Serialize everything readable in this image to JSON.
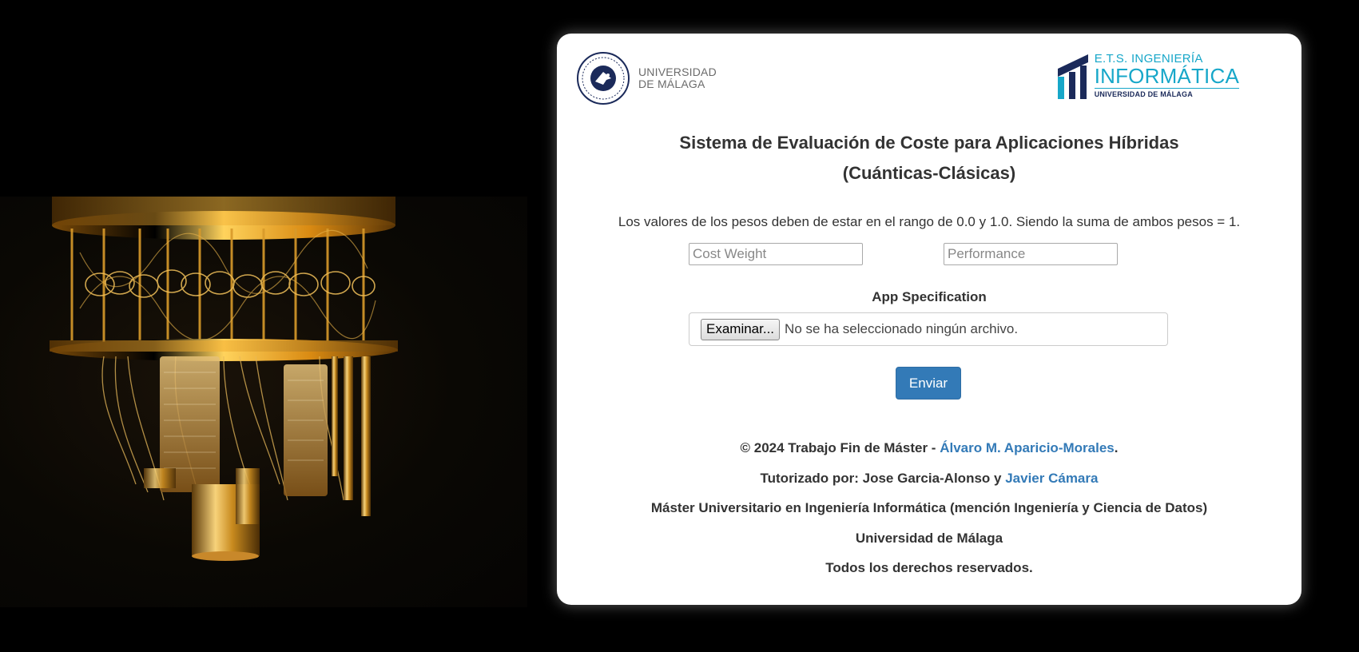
{
  "logos": {
    "uma": {
      "line1": "UNIVERSIDAD",
      "line2": "DE MÁLAGA"
    },
    "etsi": {
      "line1": "E.T.S. INGENIERÍA",
      "line2": "INFORMÁTICA",
      "line3": "UNIVERSIDAD DE MÁLAGA"
    }
  },
  "title": {
    "line1": "Sistema de Evaluación de Coste para Aplicaciones Híbridas",
    "line2": "(Cuánticas-Clásicas)"
  },
  "form": {
    "weights_note": "Los valores de los pesos deben de estar en el rango de 0.0 y 1.0. Siendo la suma de ambos pesos = 1.",
    "cost_weight": {
      "placeholder": "Cost Weight",
      "value": ""
    },
    "performance": {
      "placeholder": "Performance",
      "value": ""
    },
    "app_spec_label": "App Specification",
    "file_button_label": "Examinar...",
    "file_status": "No se ha seleccionado ningún archivo.",
    "submit_label": "Enviar"
  },
  "footer": {
    "copyright_prefix": "© 2024 Trabajo Fin de Máster - ",
    "author_link": "Álvaro M. Aparicio-Morales",
    "copyright_suffix": ".",
    "tutor_prefix": "Tutorizado por: Jose Garcia-Alonso y ",
    "tutor_link": "Javier Cámara",
    "degree": "Máster Universitario en Ingeniería Informática (mención Ingeniería y Ciencia de Datos)",
    "university": "Universidad de Málaga",
    "rights": "Todos los derechos reservados."
  },
  "colors": {
    "link": "#337ab7",
    "button": "#337ab7",
    "etsi_cyan": "#17a7c9",
    "etsi_navy": "#1b2a5a"
  }
}
